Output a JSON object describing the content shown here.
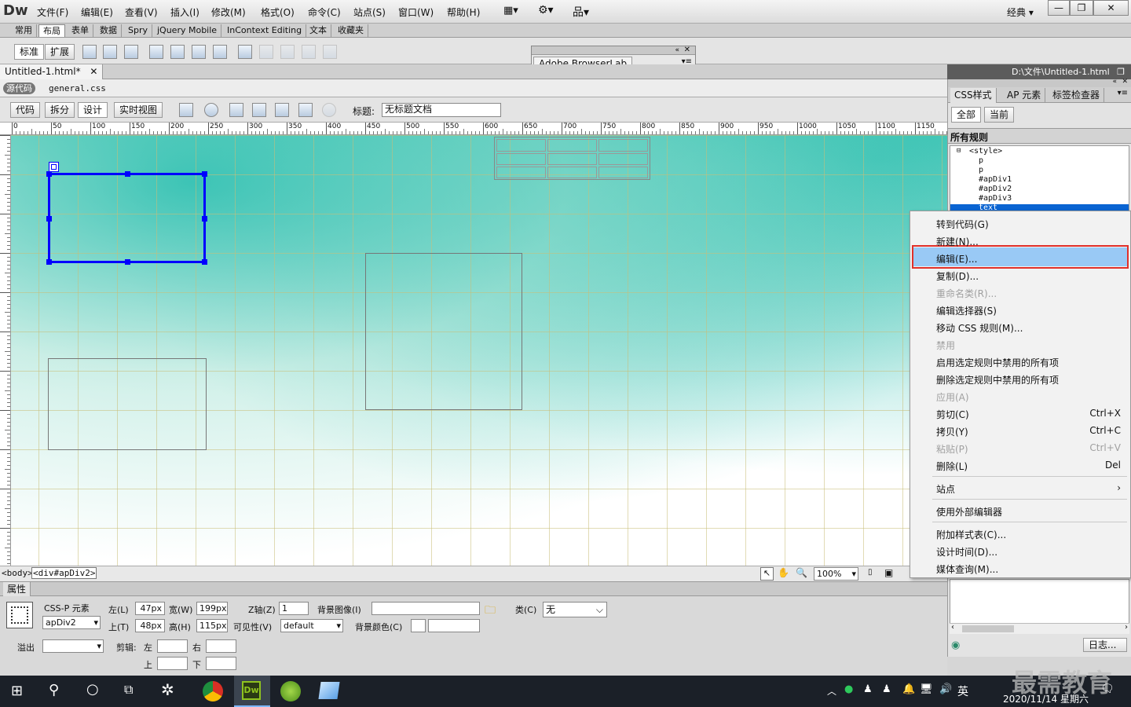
{
  "menubar": {
    "logo": "Dw",
    "items": [
      "文件(F)",
      "编辑(E)",
      "查看(V)",
      "插入(I)",
      "修改(M)",
      "格式(O)",
      "命令(C)",
      "站点(S)",
      "窗口(W)",
      "帮助(H)"
    ],
    "workspace": "经典"
  },
  "insert_tabs": [
    "常用",
    "布局",
    "表单",
    "数据",
    "Spry",
    "jQuery Mobile",
    "InContext Editing",
    "文本",
    "收藏夹"
  ],
  "insert_bar": {
    "standard": "标准",
    "expanded": "扩展"
  },
  "browserlab": {
    "title": "Adobe BrowserLab"
  },
  "document": {
    "tab": "Untitled-1.html*",
    "path": "D:\\文件\\Untitled-1.html",
    "source_label": "源代码",
    "related_file": "general.css",
    "views": [
      "代码",
      "拆分",
      "设计",
      "实时视图"
    ],
    "title_label": "标题:",
    "title_value": "无标题文档"
  },
  "ruler": {
    "labels": [
      "0",
      "50",
      "100",
      "150",
      "200",
      "250",
      "300",
      "350",
      "400",
      "450",
      "500",
      "550",
      "600",
      "650",
      "700",
      "750",
      "800",
      "850",
      "900",
      "950",
      "1000",
      "1050",
      "1100",
      "1150"
    ]
  },
  "status": {
    "tags": [
      "<body>",
      "<div#apDiv2>"
    ],
    "zoom": "100%"
  },
  "properties": {
    "header": "属性",
    "element_type": "CSS-P 元素",
    "element_id": "apDiv2",
    "left_label": "左(L)",
    "left_value": "47px",
    "top_label": "上(T)",
    "top_value": "48px",
    "width_label": "宽(W)",
    "width_value": "199px",
    "height_label": "高(H)",
    "height_value": "115px",
    "z_label": "Z轴(Z)",
    "z_value": "1",
    "vis_label": "可见性(V)",
    "vis_value": "default",
    "bgimg_label": "背景图像(I)",
    "bgcolor_label": "背景颜色(C)",
    "class_label": "类(C)",
    "class_value": "无",
    "overflow_label": "溢出",
    "clip_label": "剪辑:",
    "clip_left": "左",
    "clip_right": "右",
    "clip_top": "上",
    "clip_bottom": "下"
  },
  "css_panel": {
    "tabs": [
      "CSS样式",
      "AP 元素",
      "标签检查器"
    ],
    "modes": [
      "全部",
      "当前"
    ],
    "section": "所有规则",
    "rules": [
      "<style>",
      "p",
      "p",
      "#apDiv1",
      "#apDiv2",
      "#apDiv3",
      "text"
    ],
    "log_button": "日志..."
  },
  "context_menu": {
    "items": [
      {
        "label": "转到代码(G)",
        "shortcut": "",
        "disabled": false
      },
      {
        "label": "新建(N)...",
        "shortcut": "",
        "disabled": false
      },
      {
        "label": "编辑(E)...",
        "shortcut": "",
        "disabled": false,
        "highlighted": true
      },
      {
        "label": "复制(D)...",
        "shortcut": "",
        "disabled": false
      },
      {
        "label": "重命名类(R)...",
        "shortcut": "",
        "disabled": true
      },
      {
        "label": "编辑选择器(S)",
        "shortcut": "",
        "disabled": false
      },
      {
        "label": "移动 CSS 规则(M)...",
        "shortcut": "",
        "disabled": false
      },
      {
        "label": "禁用",
        "shortcut": "",
        "disabled": true
      },
      {
        "label": "启用选定规则中禁用的所有项",
        "shortcut": "",
        "disabled": false
      },
      {
        "label": "删除选定规则中禁用的所有项",
        "shortcut": "",
        "disabled": false
      },
      {
        "label": "应用(A)",
        "shortcut": "",
        "disabled": true
      },
      {
        "label": "剪切(C)",
        "shortcut": "Ctrl+X",
        "disabled": false
      },
      {
        "label": "拷贝(Y)",
        "shortcut": "Ctrl+C",
        "disabled": false
      },
      {
        "label": "粘贴(P)",
        "shortcut": "Ctrl+V",
        "disabled": true
      },
      {
        "label": "删除(L)",
        "shortcut": "Del",
        "disabled": false
      },
      {
        "label": "站点",
        "shortcut": "›",
        "disabled": false
      },
      {
        "label": "使用外部编辑器",
        "shortcut": "",
        "disabled": false
      },
      {
        "label": "附加样式表(C)...",
        "shortcut": "",
        "disabled": false
      },
      {
        "label": "设计时间(D)...",
        "shortcut": "",
        "disabled": false
      },
      {
        "label": "媒体查询(M)...",
        "shortcut": "",
        "disabled": false
      }
    ]
  },
  "taskbar": {
    "ime": "英",
    "date": "2020/11/14 星期六",
    "watermark": "最需教育"
  },
  "colors": {
    "selection": "#0000ff",
    "highlight": "#99c9f5",
    "highlight_border": "#e0302a",
    "accent": "#0a64d2"
  }
}
